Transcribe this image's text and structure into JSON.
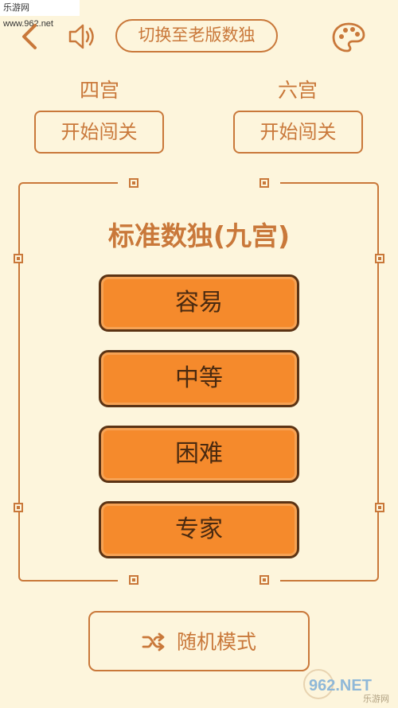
{
  "watermark": {
    "top_left": "乐游网 www.962.net",
    "bottom_right_brand": "962.NET",
    "bottom_right_sub": "乐游网"
  },
  "topbar": {
    "switch_label": "切换至老版数独"
  },
  "small_modes": [
    {
      "title": "四宫",
      "button": "开始闯关"
    },
    {
      "title": "六宫",
      "button": "开始闯关"
    }
  ],
  "standard": {
    "title": "标准数独(九宫)",
    "levels": [
      "容易",
      "中等",
      "困难",
      "专家"
    ]
  },
  "random_mode": {
    "label": "随机模式"
  },
  "colors": {
    "background": "#fdf5dc",
    "accent": "#c9783a",
    "button_fill": "#f58a2c",
    "button_border": "#5b3314"
  }
}
